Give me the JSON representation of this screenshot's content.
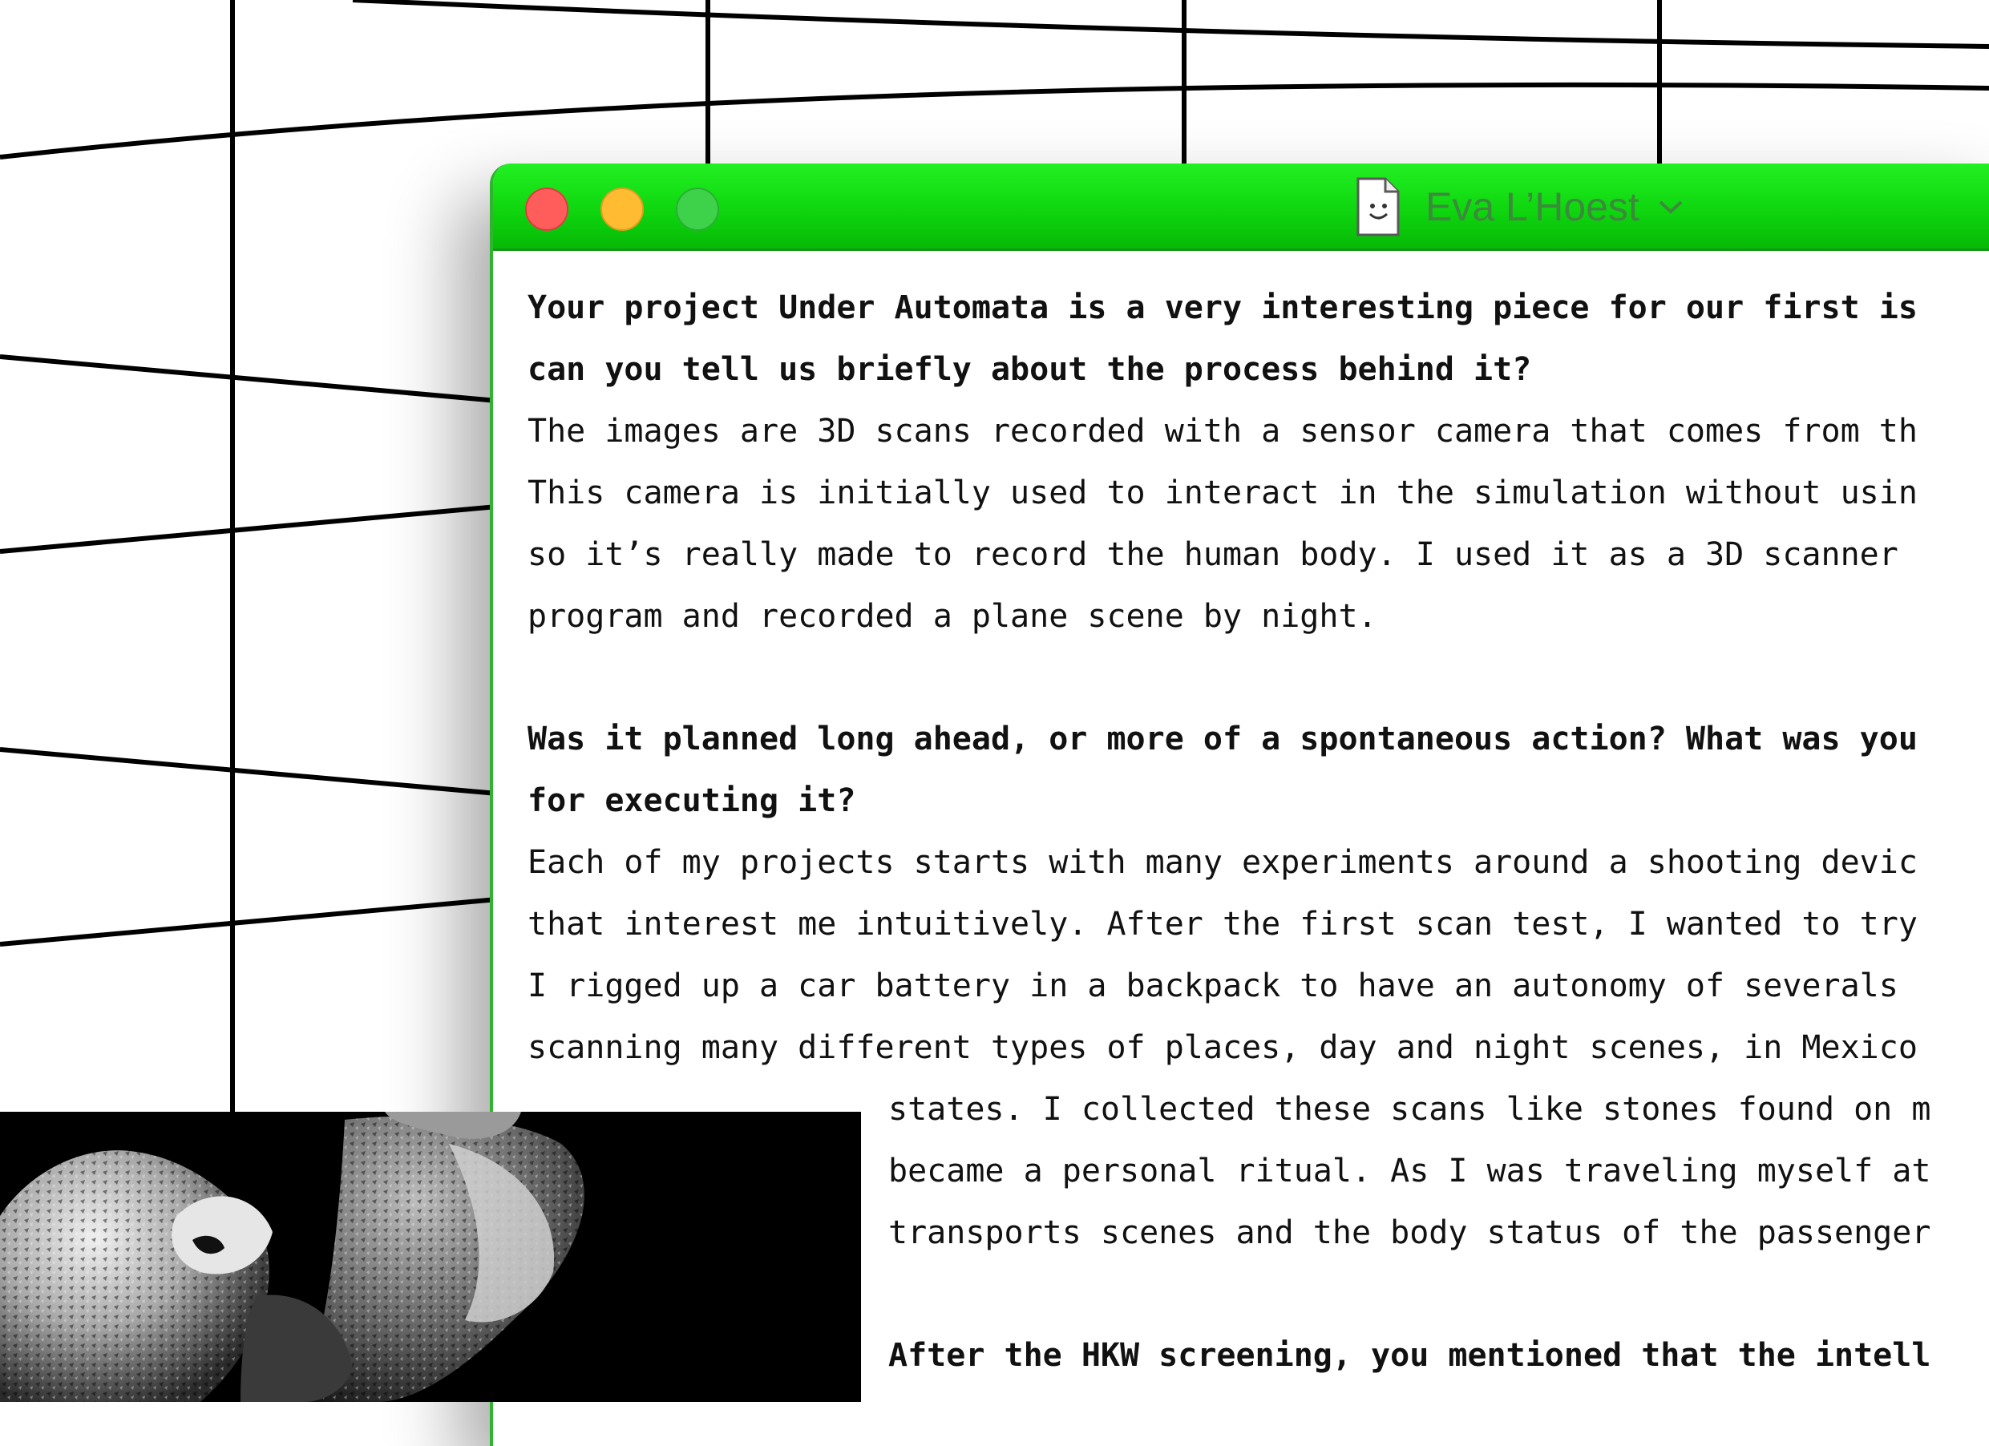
{
  "window": {
    "title": "Eva L’Hoest",
    "icons": {
      "close": "red-close-icon",
      "minimize": "yellow-minimize-icon",
      "zoom": "green-zoom-icon",
      "document": "smiley-document-icon",
      "title_menu": "chevron-down-icon"
    },
    "colors": {
      "titlebar": "#0fd60f",
      "close": "#ff5c5c",
      "minimize": "#ffbc32",
      "zoom": "#3ed24a"
    }
  },
  "interview": {
    "q1": [
      "Your project Under Automata is a very interesting piece for our first is",
      "can you tell us briefly about the process behind it?"
    ],
    "a1": [
      "The images are 3D scans recorded with a sensor camera that comes from th",
      "This camera is initially used to interact in the simulation without usin",
      "so it’s really made to record the human body. I used it as a 3D scanner",
      "program and recorded a plane scene by night."
    ],
    "q2": [
      "Was it planned long ahead, or more of a spontaneous action? What was you",
      "for executing it?"
    ],
    "a2": [
      "Each of my projects starts with many experiments around a shooting devic",
      "that interest me intuitively. After the first scan test, I wanted to try",
      "I rigged up a car battery in a backpack to have an autonomy of severals",
      "scanning many different types of places, day and night scenes, in Mexico",
      "states. I collected these scans like stones found on m",
      "became a personal ritual. As I was traveling myself at",
      "transports scenes and the body status of the passenger"
    ],
    "q3": [
      "After the HKW screening, you mentioned that the intell"
    ]
  }
}
